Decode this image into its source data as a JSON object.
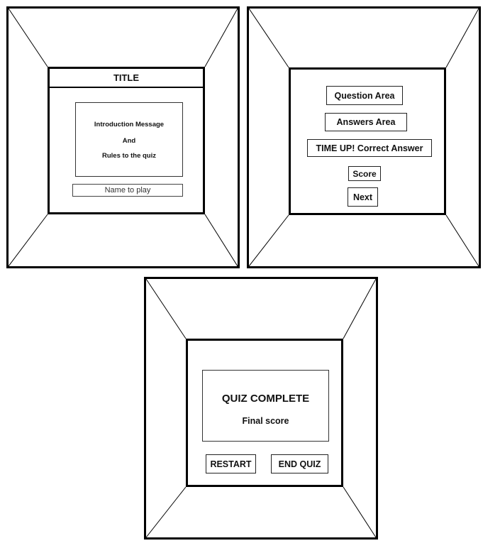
{
  "screen1": {
    "title": "TITLE",
    "intro_line1": "Introduction Message",
    "intro_line2": "And",
    "intro_line3": "Rules to the quiz",
    "name_placeholder": "Name to play"
  },
  "screen2": {
    "question": "Question Area",
    "answers": "Answers Area",
    "time_up": "TIME UP! Correct Answer",
    "score": "Score",
    "next": "Next"
  },
  "screen3": {
    "heading": "QUIZ COMPLETE",
    "final_score": "Final score",
    "restart": "RESTART",
    "end_quiz": "END QUIZ"
  }
}
